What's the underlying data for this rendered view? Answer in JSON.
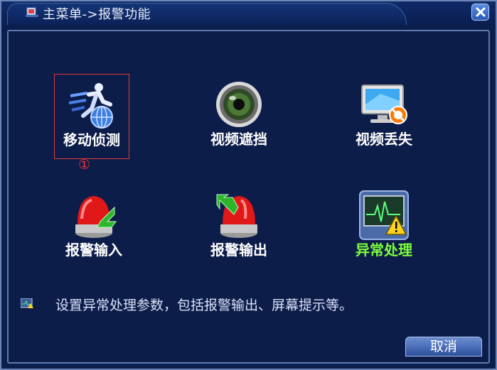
{
  "window": {
    "title": "主菜单->报警功能"
  },
  "items": [
    {
      "label": "移动侦测",
      "icon": "motion-detect-icon"
    },
    {
      "label": "视频遮挡",
      "icon": "video-blind-icon"
    },
    {
      "label": "视频丢失",
      "icon": "video-loss-icon"
    },
    {
      "label": "报警输入",
      "icon": "alarm-input-icon"
    },
    {
      "label": "报警输出",
      "icon": "alarm-output-icon"
    },
    {
      "label": "异常处理",
      "icon": "abnormality-icon"
    }
  ],
  "marker": "①",
  "hint": "设置异常处理参数，包括报警输出、屏幕提示等。",
  "buttons": {
    "cancel": "取消"
  },
  "colors": {
    "highlight": "#7dff3a",
    "selection_border": "#e03a3a",
    "background": "#0b1e4c"
  }
}
